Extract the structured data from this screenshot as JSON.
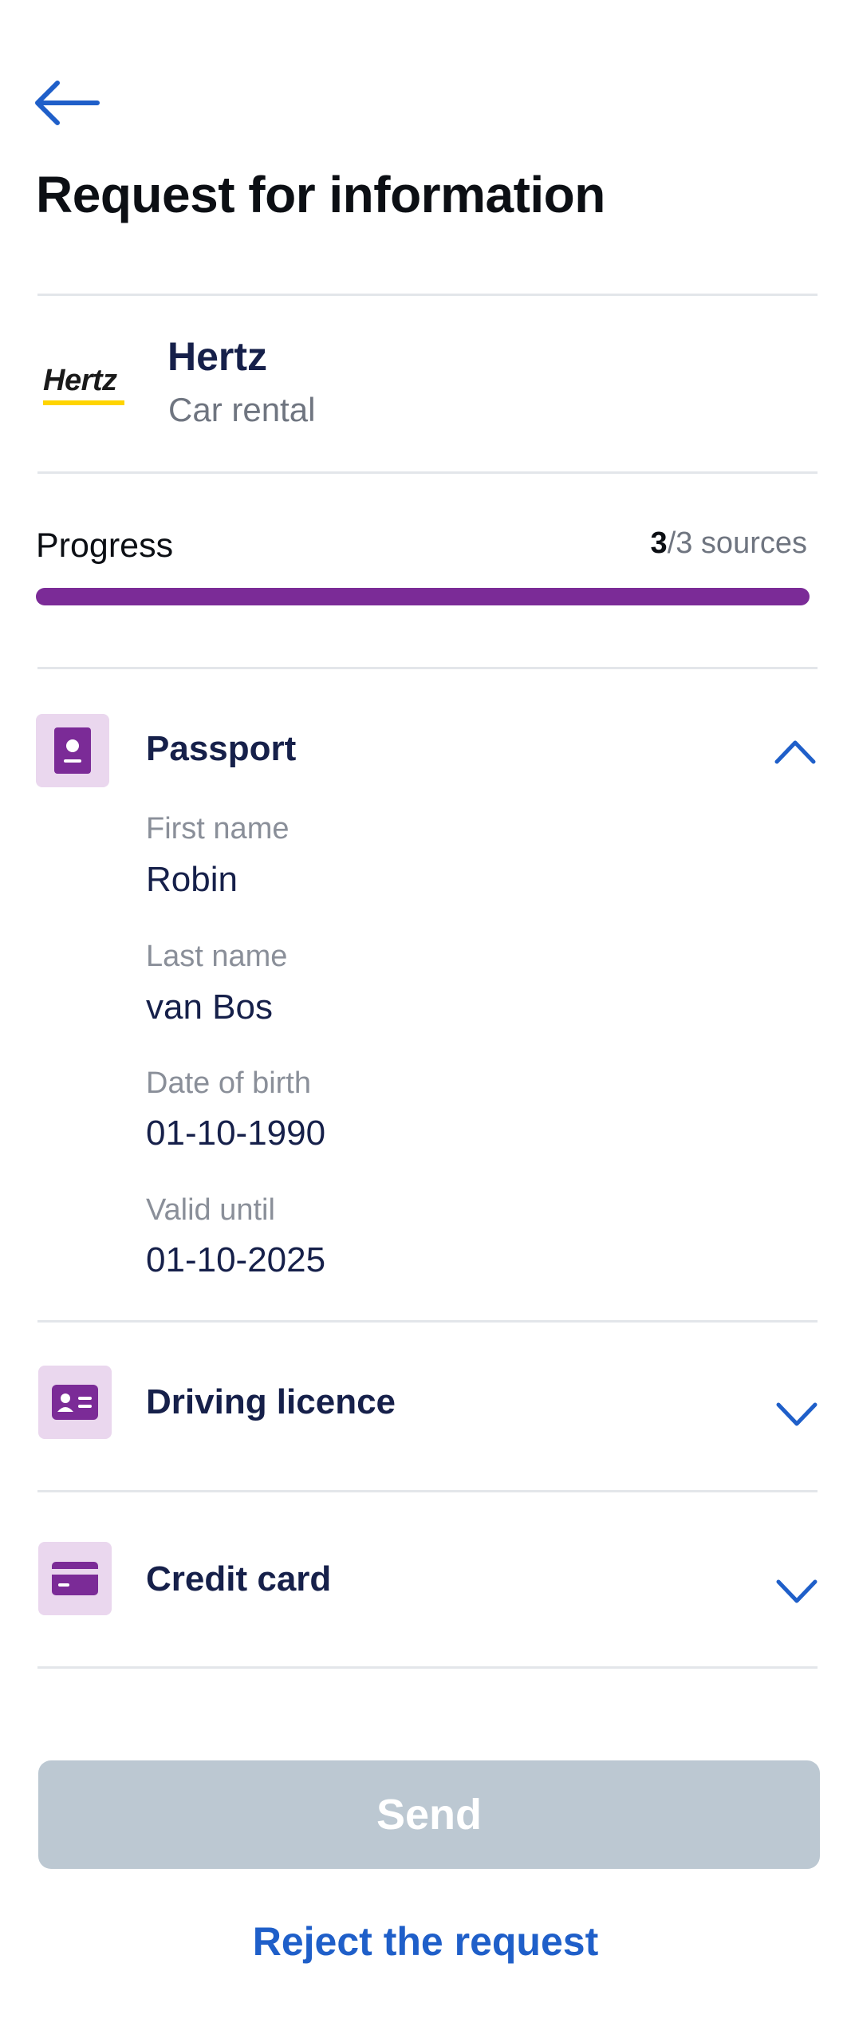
{
  "header": {
    "title": "Request for information",
    "back_icon": "arrow-left-icon"
  },
  "organization": {
    "name": "Hertz",
    "category": "Car rental",
    "logo_text": "Hertz"
  },
  "progress": {
    "label": "Progress",
    "current": "3",
    "total_text": "/3 sources",
    "fraction": 1.0
  },
  "sections": {
    "passport": {
      "title": "Passport",
      "icon": "passport-icon",
      "expanded": true,
      "fields": [
        {
          "label": "First name",
          "value": "Robin"
        },
        {
          "label": "Last name",
          "value": "van Bos"
        },
        {
          "label": "Date of birth",
          "value": "01-10-1990"
        },
        {
          "label": "Valid until",
          "value": "01-10-2025"
        }
      ]
    },
    "driving_licence": {
      "title": "Driving licence",
      "icon": "id-card-icon",
      "expanded": false
    },
    "credit_card": {
      "title": "Credit card",
      "icon": "credit-card-icon",
      "expanded": false
    }
  },
  "actions": {
    "send_label": "Send",
    "reject_label": "Reject the request"
  },
  "colors": {
    "accent": "#1f5fc9",
    "progress": "#7b2b97",
    "icon_bg": "#ead7ee",
    "disabled_button": "#bcc8d2"
  }
}
